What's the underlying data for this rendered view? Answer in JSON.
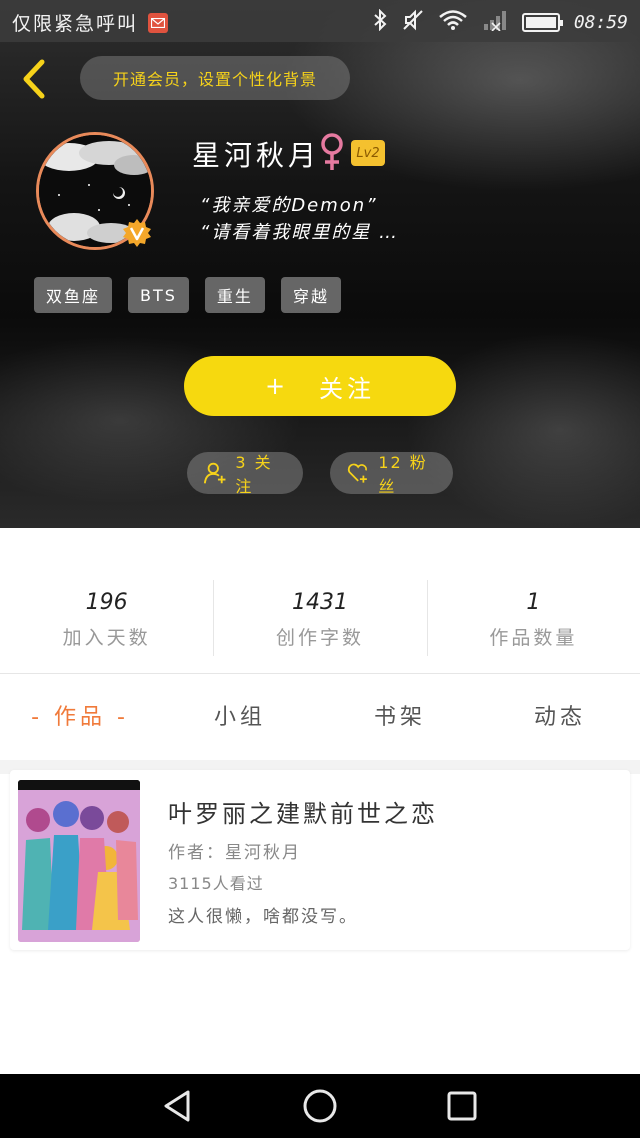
{
  "status_bar": {
    "carrier": "仅限紧急呼叫",
    "time": "08:59",
    "icons": [
      "mail-icon",
      "bluetooth-icon",
      "mute-icon",
      "wifi-icon",
      "signal-icon",
      "battery-icon"
    ]
  },
  "header": {
    "vip_banner": "开通会员，设置个性化背景",
    "username": "星河秋月",
    "gender": "female",
    "level": "Lv2",
    "bio_line1": "“我亲爱的Demon”",
    "bio_line2": "“请看着我眼里的星 …",
    "tags": [
      "双鱼座",
      "BTS",
      "重生",
      "穿越"
    ],
    "follow_plus": "+",
    "follow_label": "关注",
    "following_label": "3 关注",
    "fans_label": "12 粉丝"
  },
  "stats": [
    {
      "value": "196",
      "label": "加入天数"
    },
    {
      "value": "1431",
      "label": "创作字数"
    },
    {
      "value": "1",
      "label": "作品数量"
    }
  ],
  "tabs": [
    {
      "label": "- 作品 -",
      "active": true
    },
    {
      "label": "小组",
      "active": false
    },
    {
      "label": "书架",
      "active": false
    },
    {
      "label": "动态",
      "active": false
    }
  ],
  "works": [
    {
      "title": "叶罗丽之建默前世之恋",
      "author": "作者：星河秋月",
      "views": "3115人看过",
      "description": "这人很懒，啥都没写。"
    }
  ],
  "colors": {
    "accent_yellow": "#f6d90f",
    "tab_active": "#f07a3a",
    "avatar_border": "#e98a5a",
    "level_badge": "#f4c12f"
  }
}
